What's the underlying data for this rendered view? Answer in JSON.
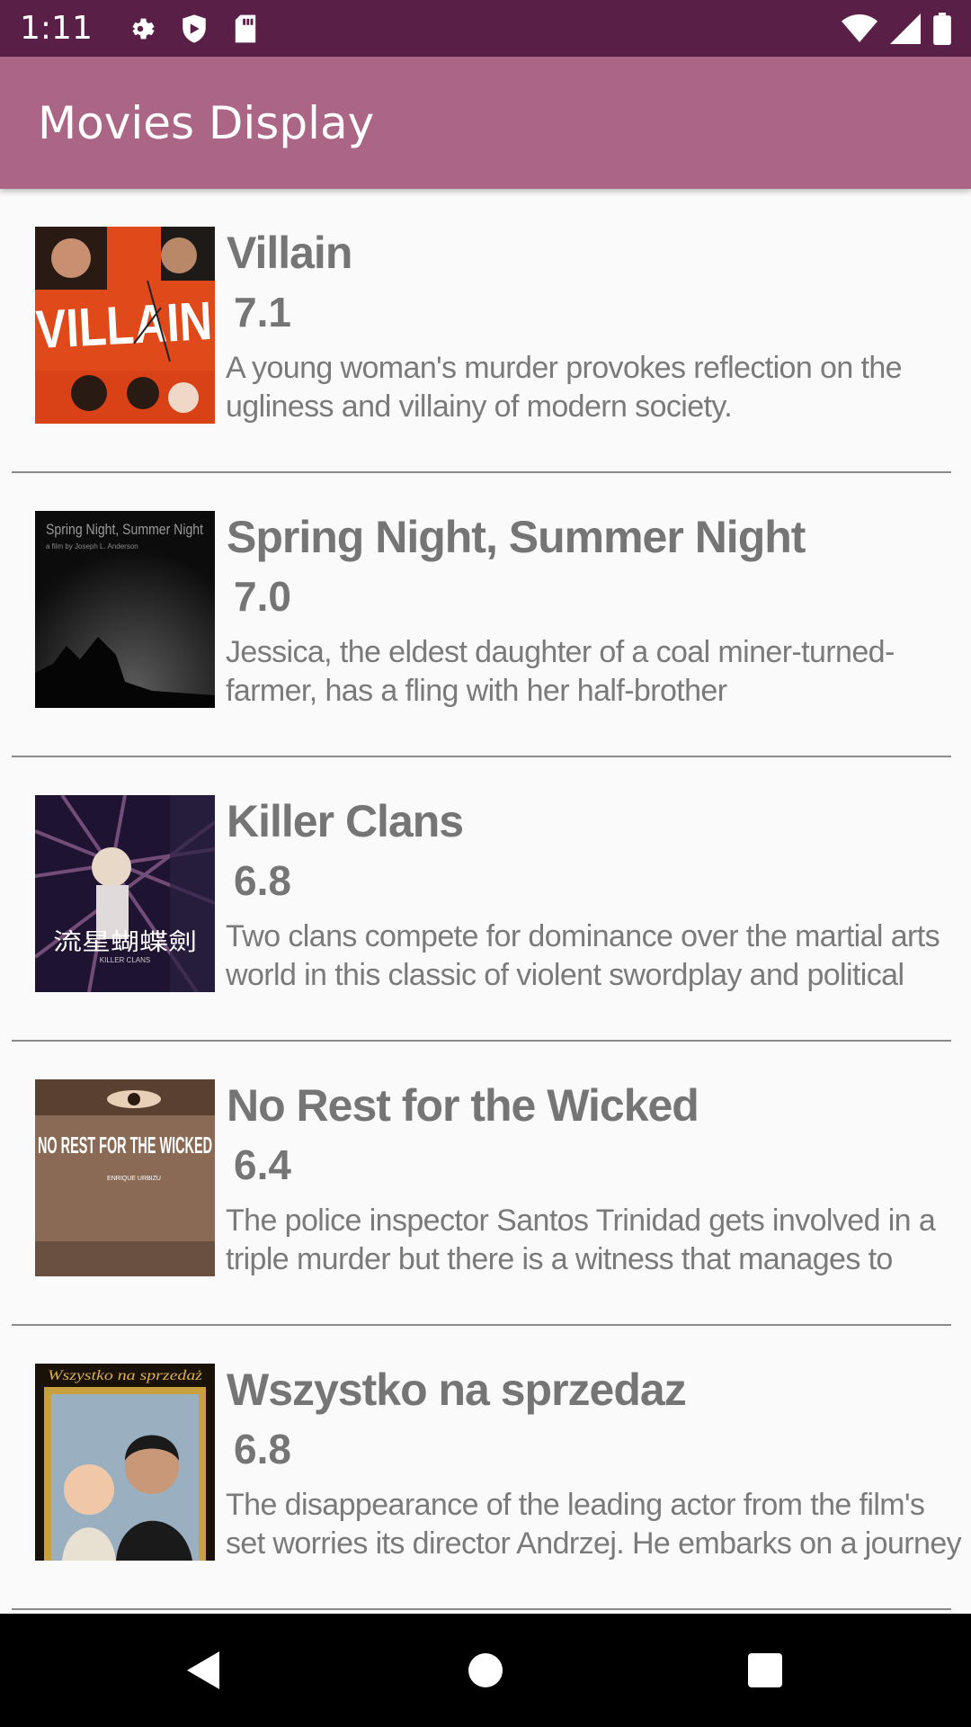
{
  "status_bar": {
    "time": "1:11",
    "icons": [
      "gear-icon",
      "shield-icon",
      "sd-card-icon"
    ],
    "right_icons": [
      "wifi-icon",
      "signal-icon",
      "battery-icon"
    ]
  },
  "app_bar": {
    "title": "Movies Display"
  },
  "movies": [
    {
      "title": "Villain",
      "rating": "7.1",
      "overview": "A young woman's murder provokes reflection on the ugliness and villainy of modern society.",
      "poster_text": "VILLAIN"
    },
    {
      "title": "Spring Night, Summer Night",
      "rating": "7.0",
      "overview": "Jessica, the eldest daughter of a coal miner-turned-farmer, has a fling with her half-brother",
      "poster_text": "Spring Night, Summer Night",
      "poster_subtext": "a film by Joseph L. Anderson"
    },
    {
      "title": "Killer Clans",
      "rating": "6.8",
      "overview": "Two clans compete for dominance over the martial arts world in this classic of violent swordplay and political",
      "poster_text": "流星蝴蝶劍",
      "poster_subtext": "KILLER CLANS"
    },
    {
      "title": "No Rest for the Wicked",
      "rating": "6.4",
      "overview": "The police inspector Santos Trinidad gets involved in a triple murder but there is a witness that manages to",
      "poster_text": "NO REST FOR THE WICKED",
      "poster_subtext": "ENRIQUE URBIZU"
    },
    {
      "title": "Wszystko na sprzedaz",
      "rating": "6.8",
      "overview": "The disappearance of the leading actor from the film's set worries its director Andrzej. He embarks on a journey",
      "poster_text": "Wszystko na sprzedaż"
    }
  ],
  "nav_bar": {
    "buttons": [
      "back-icon",
      "home-icon",
      "recents-icon"
    ]
  },
  "colors": {
    "status_bar": "#5a1f46",
    "app_bar": "#ab6685",
    "text_gray": "#757575"
  }
}
